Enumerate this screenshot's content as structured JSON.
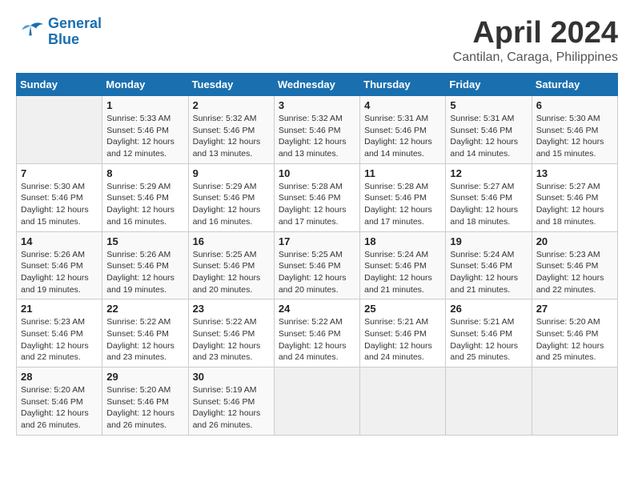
{
  "header": {
    "logo_line1": "General",
    "logo_line2": "Blue",
    "month": "April 2024",
    "location": "Cantilan, Caraga, Philippines"
  },
  "columns": [
    "Sunday",
    "Monday",
    "Tuesday",
    "Wednesday",
    "Thursday",
    "Friday",
    "Saturday"
  ],
  "weeks": [
    [
      {
        "day": "",
        "detail": ""
      },
      {
        "day": "1",
        "detail": "Sunrise: 5:33 AM\nSunset: 5:46 PM\nDaylight: 12 hours\nand 12 minutes."
      },
      {
        "day": "2",
        "detail": "Sunrise: 5:32 AM\nSunset: 5:46 PM\nDaylight: 12 hours\nand 13 minutes."
      },
      {
        "day": "3",
        "detail": "Sunrise: 5:32 AM\nSunset: 5:46 PM\nDaylight: 12 hours\nand 13 minutes."
      },
      {
        "day": "4",
        "detail": "Sunrise: 5:31 AM\nSunset: 5:46 PM\nDaylight: 12 hours\nand 14 minutes."
      },
      {
        "day": "5",
        "detail": "Sunrise: 5:31 AM\nSunset: 5:46 PM\nDaylight: 12 hours\nand 14 minutes."
      },
      {
        "day": "6",
        "detail": "Sunrise: 5:30 AM\nSunset: 5:46 PM\nDaylight: 12 hours\nand 15 minutes."
      }
    ],
    [
      {
        "day": "7",
        "detail": "Sunrise: 5:30 AM\nSunset: 5:46 PM\nDaylight: 12 hours\nand 15 minutes."
      },
      {
        "day": "8",
        "detail": "Sunrise: 5:29 AM\nSunset: 5:46 PM\nDaylight: 12 hours\nand 16 minutes."
      },
      {
        "day": "9",
        "detail": "Sunrise: 5:29 AM\nSunset: 5:46 PM\nDaylight: 12 hours\nand 16 minutes."
      },
      {
        "day": "10",
        "detail": "Sunrise: 5:28 AM\nSunset: 5:46 PM\nDaylight: 12 hours\nand 17 minutes."
      },
      {
        "day": "11",
        "detail": "Sunrise: 5:28 AM\nSunset: 5:46 PM\nDaylight: 12 hours\nand 17 minutes."
      },
      {
        "day": "12",
        "detail": "Sunrise: 5:27 AM\nSunset: 5:46 PM\nDaylight: 12 hours\nand 18 minutes."
      },
      {
        "day": "13",
        "detail": "Sunrise: 5:27 AM\nSunset: 5:46 PM\nDaylight: 12 hours\nand 18 minutes."
      }
    ],
    [
      {
        "day": "14",
        "detail": "Sunrise: 5:26 AM\nSunset: 5:46 PM\nDaylight: 12 hours\nand 19 minutes."
      },
      {
        "day": "15",
        "detail": "Sunrise: 5:26 AM\nSunset: 5:46 PM\nDaylight: 12 hours\nand 19 minutes."
      },
      {
        "day": "16",
        "detail": "Sunrise: 5:25 AM\nSunset: 5:46 PM\nDaylight: 12 hours\nand 20 minutes."
      },
      {
        "day": "17",
        "detail": "Sunrise: 5:25 AM\nSunset: 5:46 PM\nDaylight: 12 hours\nand 20 minutes."
      },
      {
        "day": "18",
        "detail": "Sunrise: 5:24 AM\nSunset: 5:46 PM\nDaylight: 12 hours\nand 21 minutes."
      },
      {
        "day": "19",
        "detail": "Sunrise: 5:24 AM\nSunset: 5:46 PM\nDaylight: 12 hours\nand 21 minutes."
      },
      {
        "day": "20",
        "detail": "Sunrise: 5:23 AM\nSunset: 5:46 PM\nDaylight: 12 hours\nand 22 minutes."
      }
    ],
    [
      {
        "day": "21",
        "detail": "Sunrise: 5:23 AM\nSunset: 5:46 PM\nDaylight: 12 hours\nand 22 minutes."
      },
      {
        "day": "22",
        "detail": "Sunrise: 5:22 AM\nSunset: 5:46 PM\nDaylight: 12 hours\nand 23 minutes."
      },
      {
        "day": "23",
        "detail": "Sunrise: 5:22 AM\nSunset: 5:46 PM\nDaylight: 12 hours\nand 23 minutes."
      },
      {
        "day": "24",
        "detail": "Sunrise: 5:22 AM\nSunset: 5:46 PM\nDaylight: 12 hours\nand 24 minutes."
      },
      {
        "day": "25",
        "detail": "Sunrise: 5:21 AM\nSunset: 5:46 PM\nDaylight: 12 hours\nand 24 minutes."
      },
      {
        "day": "26",
        "detail": "Sunrise: 5:21 AM\nSunset: 5:46 PM\nDaylight: 12 hours\nand 25 minutes."
      },
      {
        "day": "27",
        "detail": "Sunrise: 5:20 AM\nSunset: 5:46 PM\nDaylight: 12 hours\nand 25 minutes."
      }
    ],
    [
      {
        "day": "28",
        "detail": "Sunrise: 5:20 AM\nSunset: 5:46 PM\nDaylight: 12 hours\nand 26 minutes."
      },
      {
        "day": "29",
        "detail": "Sunrise: 5:20 AM\nSunset: 5:46 PM\nDaylight: 12 hours\nand 26 minutes."
      },
      {
        "day": "30",
        "detail": "Sunrise: 5:19 AM\nSunset: 5:46 PM\nDaylight: 12 hours\nand 26 minutes."
      },
      {
        "day": "",
        "detail": ""
      },
      {
        "day": "",
        "detail": ""
      },
      {
        "day": "",
        "detail": ""
      },
      {
        "day": "",
        "detail": ""
      }
    ]
  ]
}
